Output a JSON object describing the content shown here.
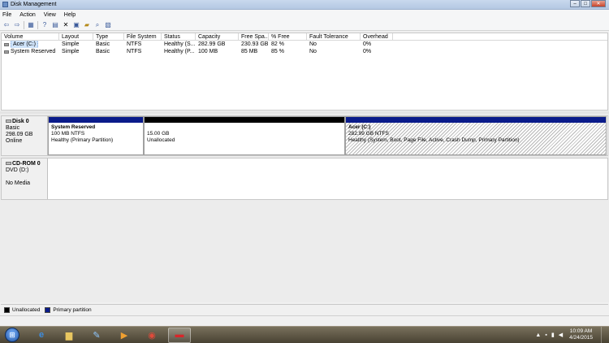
{
  "window": {
    "title": "Disk Management"
  },
  "menu": [
    "File",
    "Action",
    "View",
    "Help"
  ],
  "toolbar_icons": [
    "back-arrow-icon",
    "forward-arrow-icon",
    "details-icon",
    "help-icon",
    "console-icon",
    "delete-icon",
    "properties-icon",
    "open-icon",
    "search-icon",
    "rescan-icon"
  ],
  "volume_list": {
    "columns": [
      "Volume",
      "Layout",
      "Type",
      "File System",
      "Status",
      "Capacity",
      "Free Spa...",
      "% Free",
      "Fault Tolerance",
      "Overhead"
    ],
    "rows": [
      [
        "Acer (C:)",
        "Simple",
        "Basic",
        "NTFS",
        "Healthy (S...",
        "282.99 GB",
        "230.93 GB",
        "82 %",
        "No",
        "0%"
      ],
      [
        "System Reserved",
        "Simple",
        "Basic",
        "NTFS",
        "Healthy (P...",
        "100 MB",
        "85 MB",
        "85 %",
        "No",
        "0%"
      ]
    ]
  },
  "disk0": {
    "name": "Disk 0",
    "type": "Basic",
    "size": "298.09 GB",
    "state": "Online",
    "partitions": [
      {
        "name": "System Reserved",
        "size": "100 MB NTFS",
        "status": "Healthy (Primary Partition)",
        "kind": "primary"
      },
      {
        "name": "",
        "size": "15.00 GB",
        "status": "Unallocated",
        "kind": "unallocated"
      },
      {
        "name": "Acer  (C:)",
        "size": "282.99 GB NTFS",
        "status": "Healthy (System, Boot, Page File, Active, Crash Dump, Primary Partition)",
        "kind": "primary"
      }
    ]
  },
  "cdrom0": {
    "name": "CD-ROM 0",
    "type": "DVD (D:)",
    "media": "No Media"
  },
  "legend": [
    {
      "label": "Unallocated",
      "color": "#000000"
    },
    {
      "label": "Primary partition",
      "color": "#0a1b8a"
    }
  ],
  "taskbar": {
    "apps": [
      "internet-explorer-icon",
      "file-explorer-icon",
      "paint-icon",
      "media-player-icon",
      "chrome-icon",
      "disk-management-icon"
    ],
    "clock_time": "10:09 AM",
    "clock_date": "4/24/2015"
  }
}
